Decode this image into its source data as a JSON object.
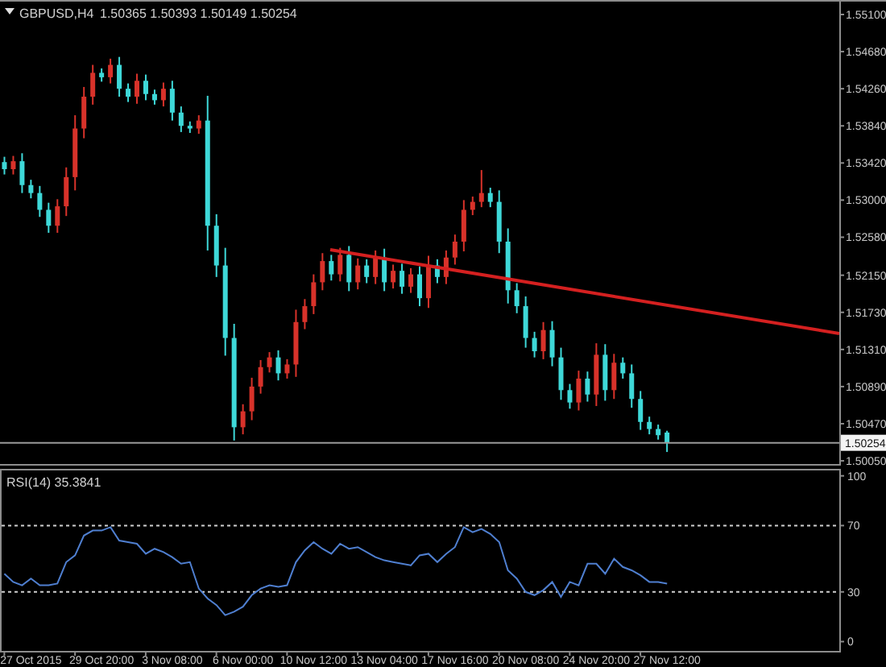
{
  "price_chart": {
    "header": {
      "symbol": "GBPUSD,H4",
      "quotes": "1.50365 1.50393 1.50149 1.50254"
    },
    "chart_data": {
      "type": "candlestick",
      "ylim": [
        1.50014,
        1.55264
      ],
      "categories": [
        null,
        null,
        null,
        null,
        null,
        null,
        null,
        null,
        null,
        null,
        null,
        null,
        null,
        null,
        null,
        null,
        null,
        null,
        null,
        null,
        null,
        null,
        null,
        null,
        null,
        null,
        null,
        null,
        null,
        null,
        null,
        null,
        null,
        null,
        null,
        null,
        null,
        null,
        null,
        null,
        null,
        null,
        null,
        null,
        null,
        null,
        null,
        null,
        null,
        null,
        null,
        null,
        null,
        null,
        null,
        null,
        null,
        null,
        null,
        null,
        null,
        null,
        null,
        null,
        null,
        null,
        null,
        null,
        null,
        null,
        null,
        null,
        null,
        null,
        null,
        null,
        null,
        null,
        null,
        null,
        null,
        null,
        null,
        null,
        null,
        null,
        null,
        null,
        null,
        null,
        null,
        null,
        null,
        null,
        null
      ],
      "ohlc": [
        [
          1.5343,
          1.5349,
          1.5329,
          1.5335
        ],
        [
          1.5335,
          1.535,
          1.5329,
          1.5344
        ],
        [
          1.5344,
          1.5353,
          1.5308,
          1.5317
        ],
        [
          1.5317,
          1.5323,
          1.5302,
          1.5308
        ],
        [
          1.5308,
          1.5316,
          1.5281,
          1.5289
        ],
        [
          1.5289,
          1.5297,
          1.5263,
          1.5271
        ],
        [
          1.5271,
          1.5301,
          1.5263,
          1.5293
        ],
        [
          1.5293,
          1.5337,
          1.5282,
          1.5326
        ],
        [
          1.5326,
          1.5396,
          1.5311,
          1.5381
        ],
        [
          1.5381,
          1.5428,
          1.537,
          1.5417
        ],
        [
          1.5417,
          1.5453,
          1.5408,
          1.5444
        ],
        [
          1.5444,
          1.5449,
          1.5434,
          1.5439
        ],
        [
          1.5439,
          1.546,
          1.5432,
          1.5453
        ],
        [
          1.5453,
          1.5462,
          1.5417,
          1.5426
        ],
        [
          1.5426,
          1.5432,
          1.5411,
          1.5417
        ],
        [
          1.5417,
          1.5443,
          1.5409,
          1.5435
        ],
        [
          1.5435,
          1.5442,
          1.5413,
          1.542
        ],
        [
          1.542,
          1.5425,
          1.5408,
          1.5413
        ],
        [
          1.5413,
          1.5433,
          1.5406,
          1.5426
        ],
        [
          1.5426,
          1.5435,
          1.539,
          1.5399
        ],
        [
          1.5399,
          1.5406,
          1.5377,
          1.5384
        ],
        [
          1.5384,
          1.5389,
          1.5376,
          1.5381
        ],
        [
          1.5381,
          1.5396,
          1.5375,
          1.539
        ],
        [
          1.539,
          1.5418,
          1.5243,
          1.5271
        ],
        [
          1.5271,
          1.5284,
          1.5213,
          1.5226
        ],
        [
          1.5226,
          1.5246,
          1.5124,
          1.5144
        ],
        [
          1.5144,
          1.516,
          1.5028,
          1.5043
        ],
        [
          1.5043,
          1.5069,
          1.5035,
          1.5061
        ],
        [
          1.5061,
          1.5099,
          1.5051,
          1.5089
        ],
        [
          1.5089,
          1.5119,
          1.5081,
          1.5111
        ],
        [
          1.5111,
          1.5128,
          1.5105,
          1.5122
        ],
        [
          1.5122,
          1.513,
          1.5096,
          1.5104
        ],
        [
          1.5104,
          1.512,
          1.5098,
          1.5114
        ],
        [
          1.5114,
          1.5176,
          1.51,
          1.5162
        ],
        [
          1.5162,
          1.5188,
          1.5154,
          1.518
        ],
        [
          1.518,
          1.5216,
          1.5171,
          1.5207
        ],
        [
          1.5207,
          1.524,
          1.5198,
          1.5231
        ],
        [
          1.5231,
          1.5238,
          1.5209,
          1.5216
        ],
        [
          1.5216,
          1.5246,
          1.5208,
          1.5238
        ],
        [
          1.5238,
          1.5248,
          1.5197,
          1.5207
        ],
        [
          1.5207,
          1.5234,
          1.5199,
          1.5226
        ],
        [
          1.5226,
          1.5233,
          1.5206,
          1.5213
        ],
        [
          1.5213,
          1.5243,
          1.5205,
          1.5235
        ],
        [
          1.5235,
          1.5245,
          1.5197,
          1.5207
        ],
        [
          1.5207,
          1.5227,
          1.52,
          1.522
        ],
        [
          1.522,
          1.5228,
          1.5194,
          1.5202
        ],
        [
          1.5202,
          1.5223,
          1.5195,
          1.5216
        ],
        [
          1.5216,
          1.5225,
          1.518,
          1.5189
        ],
        [
          1.5189,
          1.5237,
          1.5178,
          1.5226
        ],
        [
          1.5226,
          1.5233,
          1.5206,
          1.5213
        ],
        [
          1.5213,
          1.5243,
          1.5205,
          1.5235
        ],
        [
          1.5235,
          1.5261,
          1.5227,
          1.5253
        ],
        [
          1.5253,
          1.53,
          1.5242,
          1.5289
        ],
        [
          1.5289,
          1.5304,
          1.5283,
          1.5298
        ],
        [
          1.5298,
          1.5334,
          1.5292,
          1.5308
        ],
        [
          1.5308,
          1.5314,
          1.5292,
          1.5298
        ],
        [
          1.5298,
          1.5311,
          1.524,
          1.5253
        ],
        [
          1.5253,
          1.5268,
          1.5183,
          1.5198
        ],
        [
          1.5198,
          1.5206,
          1.5172,
          1.518
        ],
        [
          1.518,
          1.5191,
          1.5133,
          1.5144
        ],
        [
          1.5144,
          1.5151,
          1.5122,
          1.5129
        ],
        [
          1.5129,
          1.5162,
          1.512,
          1.5153
        ],
        [
          1.5153,
          1.5163,
          1.5112,
          1.5122
        ],
        [
          1.5122,
          1.5133,
          1.5074,
          1.5085
        ],
        [
          1.5085,
          1.5092,
          1.5064,
          1.5071
        ],
        [
          1.5071,
          1.5107,
          1.5062,
          1.5098
        ],
        [
          1.5098,
          1.5106,
          1.5072,
          1.508
        ],
        [
          1.508,
          1.5138,
          1.5067,
          1.5125
        ],
        [
          1.5125,
          1.5137,
          1.5073,
          1.5085
        ],
        [
          1.5085,
          1.5126,
          1.5075,
          1.5116
        ],
        [
          1.5116,
          1.5122,
          1.5098,
          1.5104
        ],
        [
          1.5104,
          1.5114,
          1.5065,
          1.5075
        ],
        [
          1.5075,
          1.5084,
          1.504,
          1.5049
        ],
        [
          1.5049,
          1.5055,
          1.5035,
          1.5041
        ],
        [
          1.5041,
          1.5046,
          1.5029,
          1.5034
        ],
        [
          1.5037,
          1.5039,
          1.5015,
          1.5025
        ],
        null,
        null,
        null,
        null,
        null,
        null,
        null,
        null,
        null,
        null,
        null,
        null,
        null,
        null,
        null,
        null,
        null,
        null,
        null
      ],
      "yticks": [
        {
          "value": 1.551,
          "label": "1.55100"
        },
        {
          "value": 1.5468,
          "label": "1.54680"
        },
        {
          "value": 1.5426,
          "label": "1.54260"
        },
        {
          "value": 1.5384,
          "label": "1.53840"
        },
        {
          "value": 1.5342,
          "label": "1.53420"
        },
        {
          "value": 1.53,
          "label": "1.53000"
        },
        {
          "value": 1.5258,
          "label": "1.52580"
        },
        {
          "value": 1.5215,
          "label": "1.52150"
        },
        {
          "value": 1.5173,
          "label": "1.51730"
        },
        {
          "value": 1.5131,
          "label": "1.51310"
        },
        {
          "value": 1.5089,
          "label": "1.50890"
        },
        {
          "value": 1.5047,
          "label": "1.50470"
        },
        {
          "value": 1.5005,
          "label": "1.50050"
        }
      ],
      "ref_lines": [
        {
          "axis": "y",
          "value": 1.50254,
          "label": "1.50254"
        }
      ]
    }
  },
  "rsi_chart": {
    "chart_data": {
      "type": "line",
      "title": "RSI(14) 35.3841",
      "ylim": [
        -5.6,
        105.2
      ],
      "categories": [
        null,
        null,
        null,
        "27 Oct 2015",
        null,
        null,
        null,
        null,
        null,
        null,
        null,
        "29 Oct 20:00",
        null,
        null,
        null,
        null,
        null,
        null,
        null,
        "3 Nov 08:00",
        null,
        null,
        null,
        null,
        null,
        null,
        null,
        "6 Nov 00:00",
        null,
        null,
        null,
        null,
        null,
        null,
        null,
        "10 Nov 12:00",
        null,
        null,
        null,
        null,
        null,
        null,
        null,
        "13 Nov 04:00",
        null,
        null,
        null,
        null,
        null,
        null,
        null,
        "17 Nov 16:00",
        null,
        null,
        null,
        null,
        null,
        null,
        null,
        "20 Nov 08:00",
        null,
        null,
        null,
        null,
        null,
        null,
        null,
        "24 Nov 20:00",
        null,
        null,
        null,
        null,
        null,
        null,
        null,
        "27 Nov 12:00",
        null,
        null,
        null,
        null,
        null,
        null,
        null,
        null,
        null,
        null,
        null,
        null,
        null,
        null,
        null,
        null,
        null,
        null,
        null
      ],
      "series": [
        {
          "color": "#4f7fd0",
          "values": [
            41,
            36,
            34,
            38,
            34,
            34,
            35,
            48,
            52,
            64,
            67,
            67,
            69,
            61,
            60,
            59,
            53,
            56,
            54,
            51,
            47,
            48,
            32,
            26,
            22,
            16,
            18,
            21,
            28,
            32,
            34,
            33,
            34,
            48,
            55,
            60,
            56,
            53,
            59,
            56,
            57,
            54,
            51,
            49,
            48,
            47,
            46,
            52,
            53,
            48,
            53,
            57,
            69,
            66,
            68,
            65,
            60,
            43,
            38,
            30,
            28,
            31,
            36,
            27,
            36,
            34,
            47,
            47,
            41,
            50,
            45,
            43,
            40,
            36,
            36,
            35,
            null,
            null,
            null,
            null,
            null,
            null,
            null,
            null,
            null,
            null,
            null,
            null,
            null,
            null,
            null,
            null,
            null,
            null,
            null
          ]
        }
      ],
      "yticks": [
        100,
        70,
        30,
        0
      ],
      "ref_lines": [
        {
          "axis": "y",
          "value": 70
        },
        {
          "axis": "y",
          "value": 30
        }
      ]
    }
  }
}
